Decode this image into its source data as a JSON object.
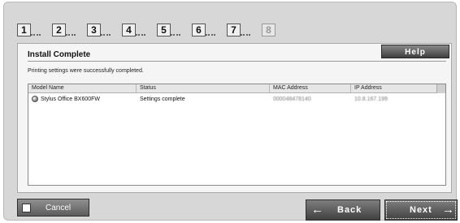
{
  "steps": [
    "1",
    "2",
    "3",
    "4",
    "5",
    "6",
    "7",
    "8"
  ],
  "current_step": 8,
  "panel": {
    "title": "Install Complete",
    "help_label": "Help",
    "message": "Printing settings were successfully completed."
  },
  "table": {
    "columns": [
      "Model Name",
      "Status",
      "MAC Address",
      "IP Address"
    ],
    "rows": [
      {
        "model": "Stylus Office BX600FW",
        "status": "Settings complete",
        "mac": "000048478140",
        "ip": "10.8.167.199"
      }
    ]
  },
  "buttons": {
    "cancel": "Cancel",
    "back": "Back",
    "next": "Next"
  },
  "icons": {
    "back": "arrow-left-icon",
    "next": "arrow-right-icon",
    "device": "printer-status-icon"
  }
}
